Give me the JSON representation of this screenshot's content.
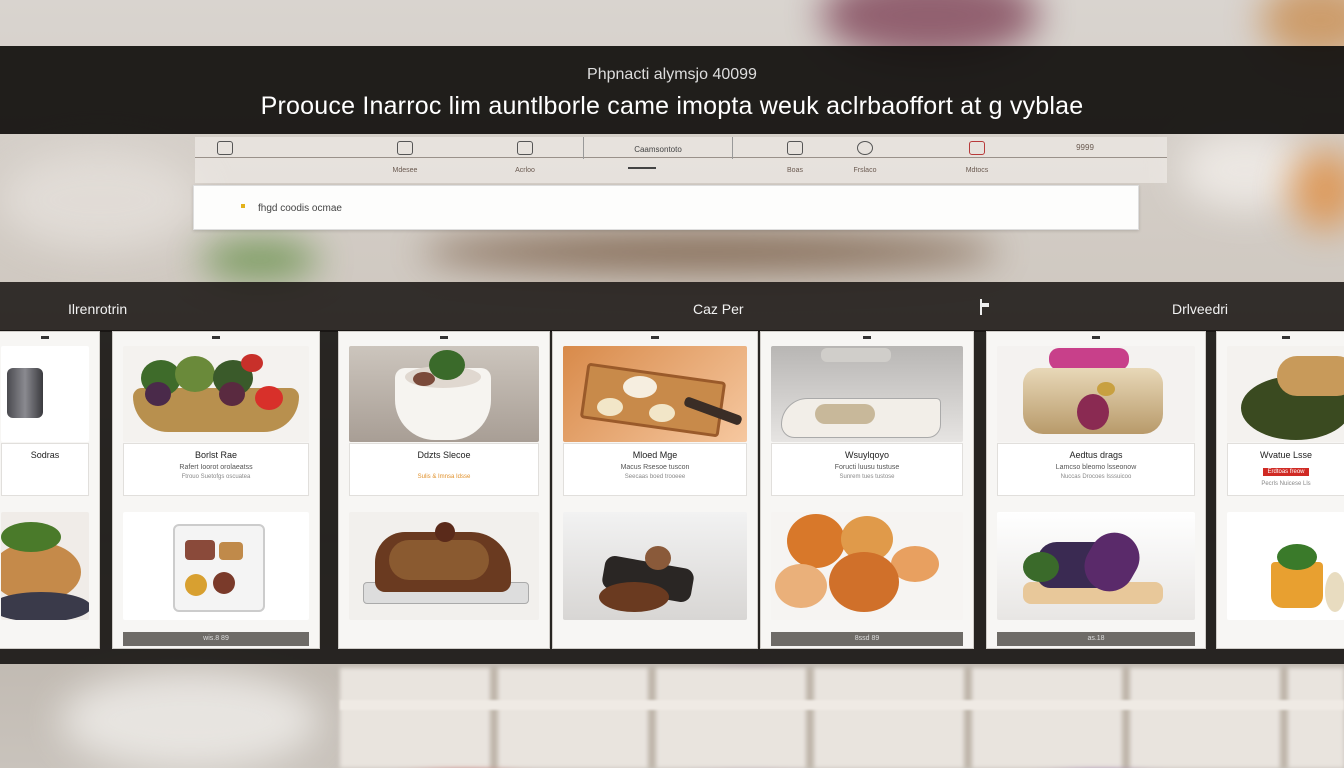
{
  "banner": {
    "subtitle": "Phpnacti alymsjo 40099",
    "title": "Proouce Inarroc lim auntlborle came imopta weuk aclrbaoffort at g vyblae"
  },
  "categories": {
    "tab_label": "Caamsontoto",
    "items": [
      {
        "label": "Mdesee",
        "icon": "kettle-icon"
      },
      {
        "label": "Acrloo",
        "icon": "cart-icon"
      },
      {
        "label": "Boas",
        "icon": "bowl-icon"
      },
      {
        "label": "Frslaco",
        "icon": "smile-icon"
      },
      {
        "label": "Mdtocs",
        "icon": "bag-icon"
      }
    ],
    "end_label": "9999"
  },
  "search": {
    "text": "fhgd coodis ocmae"
  },
  "sections": {
    "left": "Ilrenrotrin",
    "middle": "Caz Per",
    "right": "Drlveedri"
  },
  "products": [
    {
      "name": "Sodras",
      "desc": "",
      "meta": "",
      "footer": "",
      "colors": [
        "#6b6b70",
        "#3c3c40"
      ]
    },
    {
      "name": "Borlst Rae",
      "desc": "Rafert Ioorot orolaeatss",
      "meta": "Ftrouo Suetofgs oscuatea",
      "footer": "wis.8 89",
      "colors": [
        "#9c7a3c",
        "#3f6b2a"
      ]
    },
    {
      "name": "Ddzts Slecoe",
      "desc": "",
      "meta": "Sulis & Imnsa Idsse",
      "footer": "",
      "colors": [
        "#d9d3cb",
        "#5a3a1f"
      ]
    },
    {
      "name": "Mloed Mge",
      "desc": "Macus Rsesoe tuscon",
      "meta": "Seecaas boed trooeee",
      "footer": "",
      "colors": [
        "#d87a3a",
        "#3a2d26"
      ]
    },
    {
      "name": "Wsuylqoyo",
      "desc": "Foructi luusu tustuse",
      "meta": "Sunrem tues tustose",
      "footer": "8ssd 89",
      "colors": [
        "#c9c6c2",
        "#d97a2a"
      ]
    },
    {
      "name": "Aedtus drags",
      "desc": "Lamcso bleomo lsseonow",
      "meta": "Nuccas Drocoes Isssuicoo",
      "footer": "as.18",
      "colors": [
        "#c9b38a",
        "#4a2a52"
      ]
    },
    {
      "name": "Wvatue Lsse",
      "desc": "",
      "badge": "Erdtoas freow",
      "meta": "Pecrls Nuicese Lls",
      "footer": "",
      "colors": [
        "#5a4a2a",
        "#e2a23a"
      ]
    }
  ]
}
